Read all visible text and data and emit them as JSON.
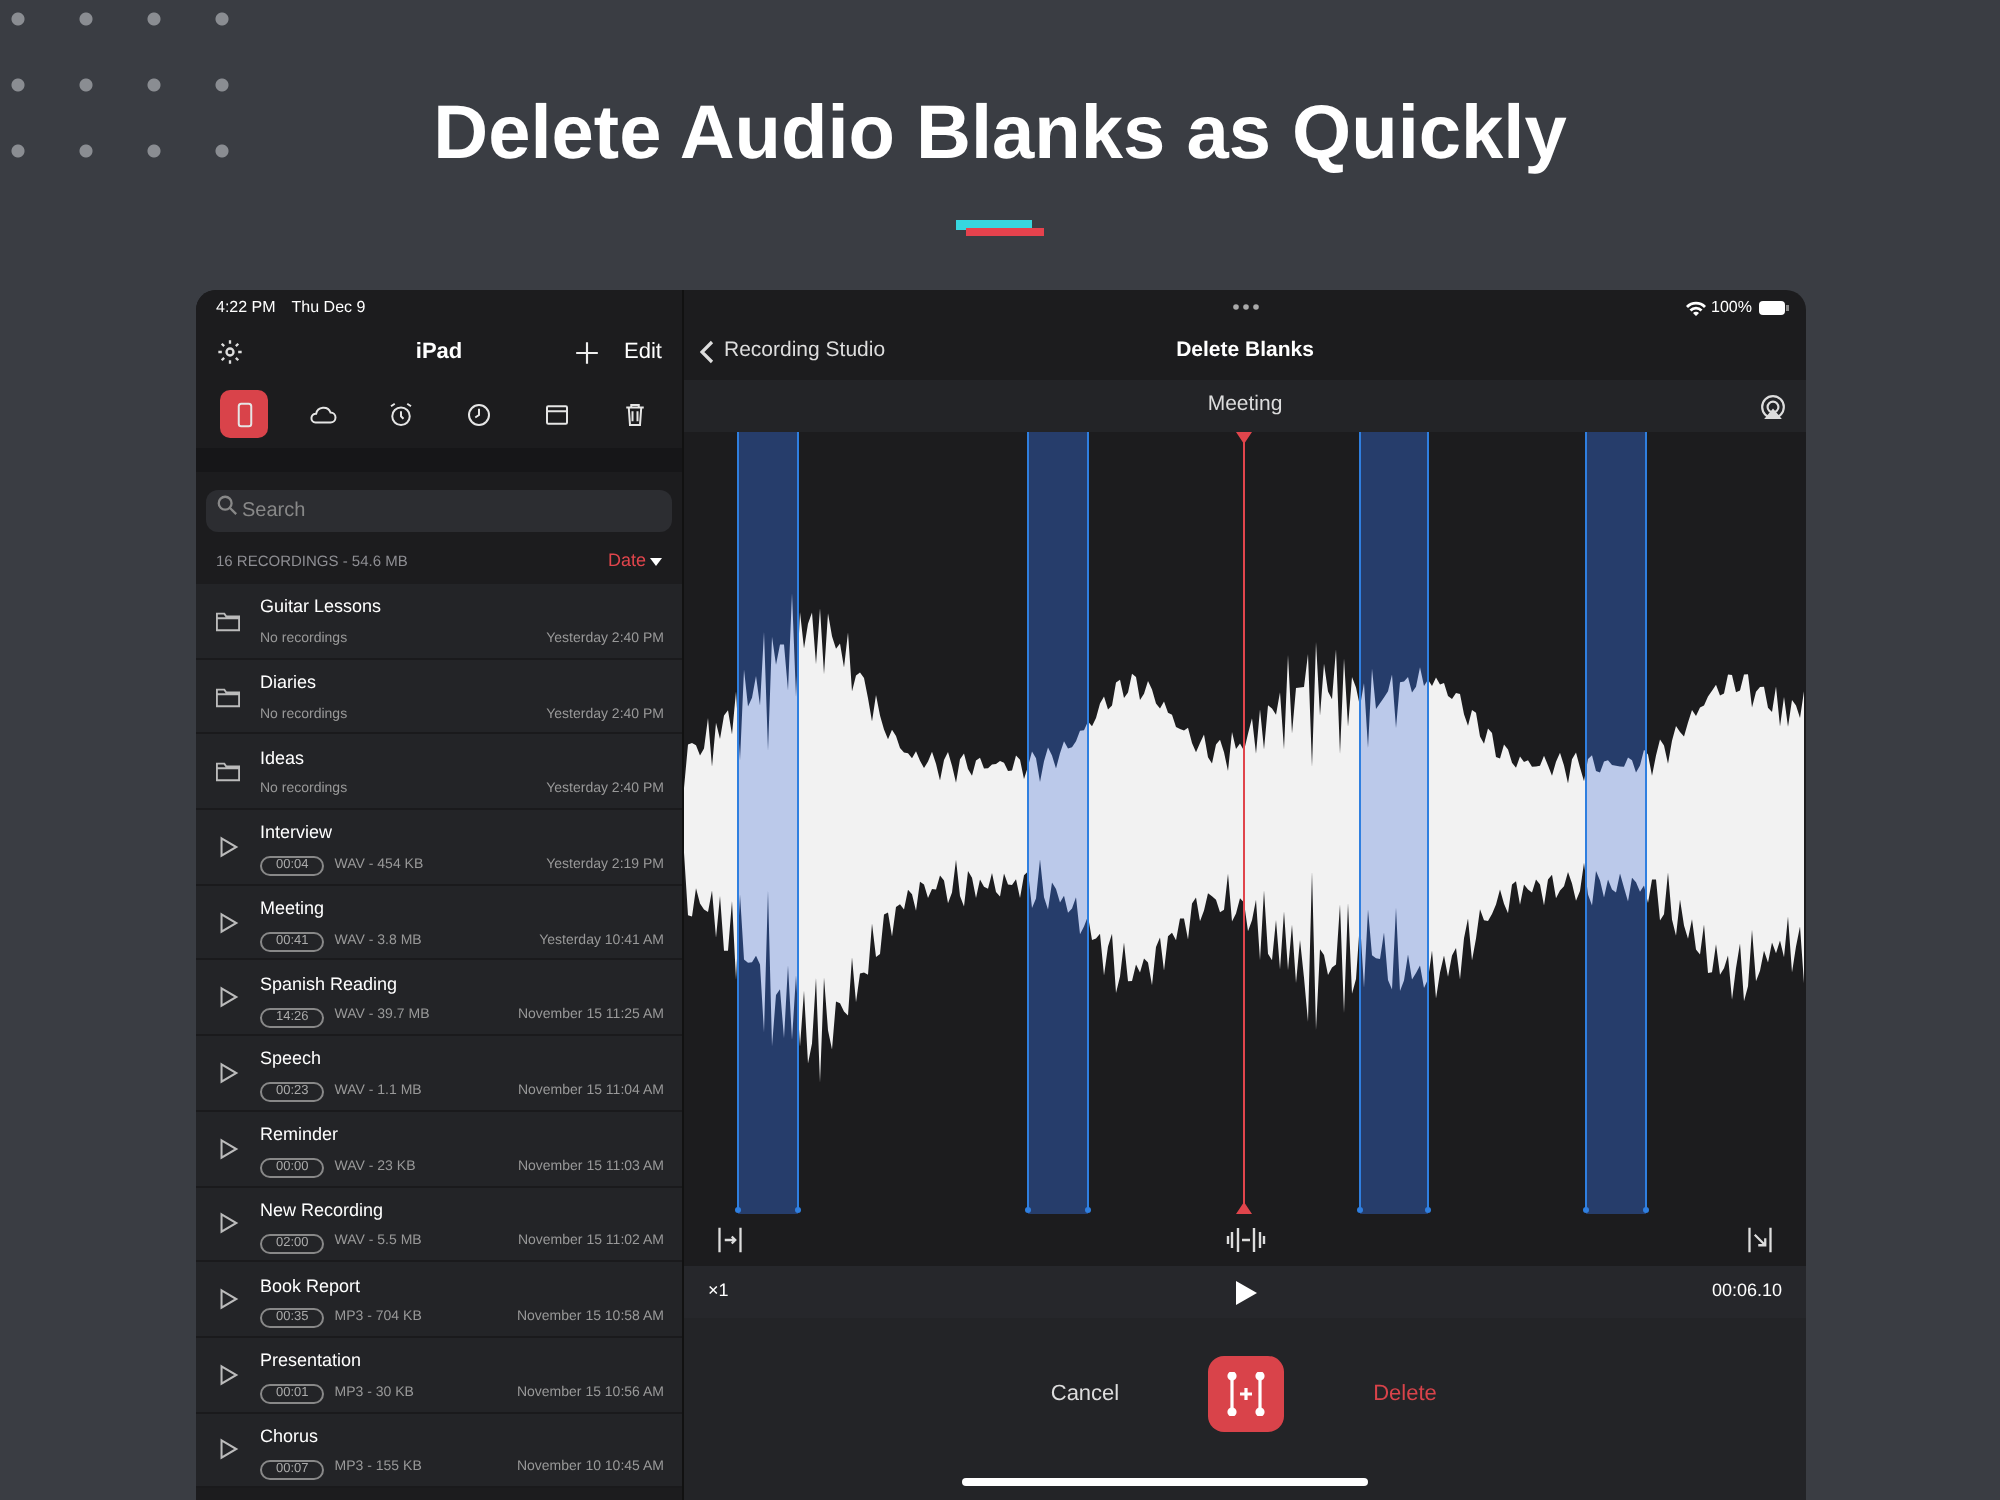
{
  "headline": "Delete Audio Blanks as Quickly",
  "status_bar": {
    "time": "4:22 PM",
    "date": "Thu Dec 9",
    "battery": "100%"
  },
  "sidebar": {
    "title": "iPad",
    "edit": "Edit",
    "tabs": [
      {
        "kind": "device",
        "selected": true
      },
      {
        "kind": "cloud",
        "selected": false
      },
      {
        "kind": "alarm",
        "selected": false
      },
      {
        "kind": "clock",
        "selected": false
      },
      {
        "kind": "calendar",
        "selected": false
      },
      {
        "kind": "trash",
        "selected": false
      }
    ],
    "search": {
      "placeholder": "Search"
    },
    "summary": "16 RECORDINGS - 54.6 MB",
    "sort": "Date",
    "items": [
      {
        "kind": "folder",
        "name": "Guitar Lessons",
        "detail": "No recordings",
        "date": "Yesterday 2:40 PM"
      },
      {
        "kind": "folder",
        "name": "Diaries",
        "detail": "No recordings",
        "date": "Yesterday 2:40 PM"
      },
      {
        "kind": "folder",
        "name": "Ideas",
        "detail": "No recordings",
        "date": "Yesterday 2:40 PM"
      },
      {
        "kind": "recording",
        "name": "Interview",
        "duration": "00:04",
        "detail": "WAV - 454 KB",
        "date": "Yesterday 2:19 PM"
      },
      {
        "kind": "recording",
        "name": "Meeting",
        "duration": "00:41",
        "detail": "WAV - 3.8 MB",
        "date": "Yesterday 10:41 AM"
      },
      {
        "kind": "recording",
        "name": "Spanish Reading",
        "duration": "14:26",
        "detail": "WAV - 39.7 MB",
        "date": "November 15 11:25 AM"
      },
      {
        "kind": "recording",
        "name": "Speech",
        "duration": "00:23",
        "detail": "WAV - 1.1 MB",
        "date": "November 15 11:04 AM"
      },
      {
        "kind": "recording",
        "name": "Reminder",
        "duration": "00:00",
        "detail": "WAV - 23 KB",
        "date": "November 15 11:03 AM"
      },
      {
        "kind": "recording",
        "name": "New Recording",
        "duration": "02:00",
        "detail": "WAV - 5.5 MB",
        "date": "November 15 11:02 AM"
      },
      {
        "kind": "recording",
        "name": "Book Report",
        "duration": "00:35",
        "detail": "MP3 - 704 KB",
        "date": "November 15 10:58 AM"
      },
      {
        "kind": "recording",
        "name": "Presentation",
        "duration": "00:01",
        "detail": "MP3 - 30 KB",
        "date": "November 15 10:56 AM"
      },
      {
        "kind": "recording",
        "name": "Chorus",
        "duration": "00:07",
        "detail": "MP3 - 155 KB",
        "date": "November 10 10:45 AM"
      }
    ]
  },
  "editor": {
    "back": "Recording Studio",
    "title": "Delete Blanks",
    "track": "Meeting",
    "speed": "×1",
    "position": "00:06.10",
    "cancel": "Cancel",
    "delete": "Delete"
  }
}
